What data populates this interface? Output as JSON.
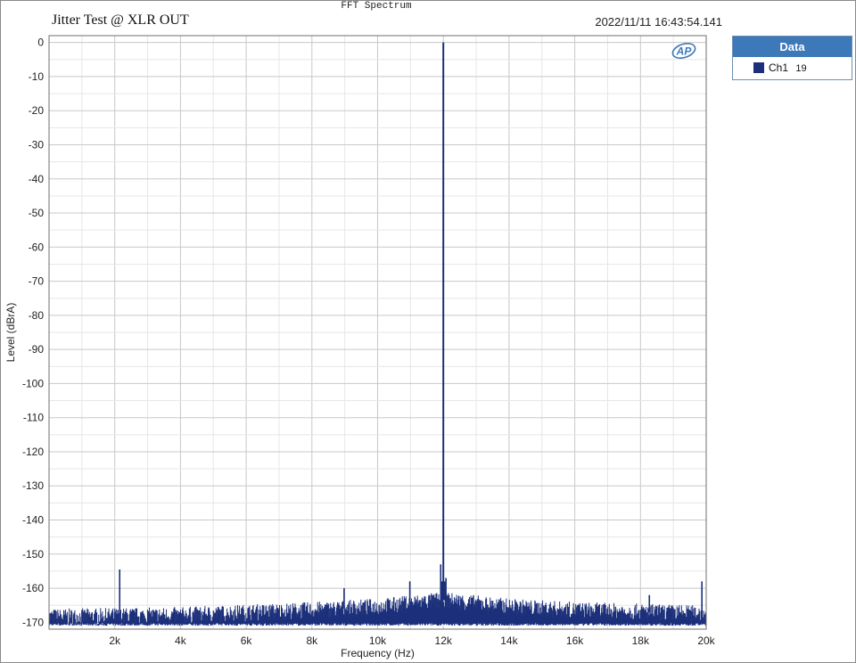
{
  "header": {
    "suptitle": "FFT Spectrum",
    "title": "Jitter Test @ XLR OUT",
    "timestamp": "2022/11/11 16:43:54.141",
    "logo": "AP"
  },
  "legend": {
    "header": "Data",
    "entries": [
      {
        "name": "Ch1",
        "value": "19",
        "color": "#1b2f7a"
      }
    ]
  },
  "colors": {
    "series": "#1b2f7a",
    "grid": "#d4d4d4",
    "axis": "#6f6f6f"
  },
  "chart_data": {
    "type": "line",
    "title": "Jitter Test @ XLR OUT",
    "xlabel": "Frequency (Hz)",
    "ylabel": "Level (dBrA)",
    "xlim": [
      0,
      20000
    ],
    "ylim": [
      -172,
      2
    ],
    "x_ticks": [
      2000,
      4000,
      6000,
      8000,
      10000,
      12000,
      14000,
      16000,
      18000,
      20000
    ],
    "x_tick_labels": [
      "2k",
      "4k",
      "6k",
      "8k",
      "10k",
      "12k",
      "14k",
      "16k",
      "18k",
      "20k"
    ],
    "y_ticks": [
      0,
      -10,
      -20,
      -30,
      -40,
      -50,
      -60,
      -70,
      -80,
      -90,
      -100,
      -110,
      -120,
      -130,
      -140,
      -150,
      -160,
      -170
    ],
    "y_tick_labels": [
      "0",
      "-10",
      "-20",
      "-30",
      "-40",
      "-50",
      "-60",
      "-70",
      "-80",
      "-90",
      "-100",
      "-110",
      "-120",
      "-130",
      "-140",
      "-150",
      "-160",
      "-170"
    ],
    "grid": true,
    "legend": "top-right outside",
    "series": [
      {
        "name": "Ch1",
        "color": "#1b2f7a",
        "baseline_floor": -171,
        "noise_floor": [
          [
            0,
            -168.5
          ],
          [
            4000,
            -168
          ],
          [
            8000,
            -166.5
          ],
          [
            10000,
            -165.5
          ],
          [
            12000,
            -163.5
          ],
          [
            14000,
            -165.5
          ],
          [
            16000,
            -166.5
          ],
          [
            20000,
            -167.5
          ]
        ],
        "peaks": [
          [
            2150,
            -154.5
          ],
          [
            8980,
            -160
          ],
          [
            10980,
            -158
          ],
          [
            11920,
            -153
          ],
          [
            11960,
            -158
          ],
          [
            12000,
            0
          ],
          [
            12040,
            -158
          ],
          [
            12080,
            -157
          ],
          [
            18270,
            -162
          ],
          [
            19870,
            -158
          ]
        ]
      }
    ]
  }
}
